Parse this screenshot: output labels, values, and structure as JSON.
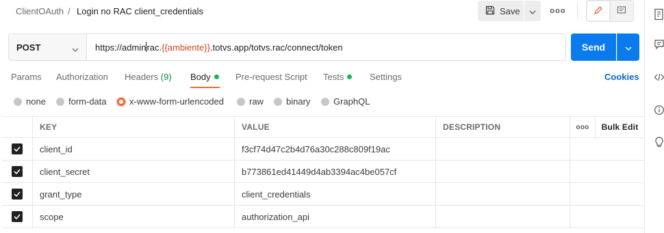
{
  "header": {
    "parent": "ClientOAuth",
    "separator": "/",
    "title": "Login no RAC client_credentials",
    "save_label": "Save",
    "more_label": "ooo"
  },
  "request": {
    "method": "POST",
    "url_prefix": "https://admin",
    "url_mid": "rac.",
    "url_var": "{{ambiente}}",
    "url_suffix": ".totvs.app/totvs.rac/connect/token",
    "send_label": "Send"
  },
  "tabs": [
    {
      "label": "Params"
    },
    {
      "label": "Authorization"
    },
    {
      "label": "Headers",
      "count": "(9)"
    },
    {
      "label": "Body"
    },
    {
      "label": "Pre-request Script"
    },
    {
      "label": "Tests"
    },
    {
      "label": "Settings"
    }
  ],
  "cookies_label": "Cookies",
  "body_types": [
    {
      "label": "none"
    },
    {
      "label": "form-data"
    },
    {
      "label": "x-www-form-urlencoded"
    },
    {
      "label": "raw"
    },
    {
      "label": "binary"
    },
    {
      "label": "GraphQL"
    }
  ],
  "selected_body_type": "x-www-form-urlencoded",
  "table": {
    "columns": {
      "key": "KEY",
      "value": "VALUE",
      "description": "DESCRIPTION",
      "more": "ooo",
      "bulk_edit": "Bulk Edit"
    },
    "rows": [
      {
        "key": "client_id",
        "value": "f3cf74d47c2b4d76a30c288c809f19ac",
        "description": "",
        "checked": true
      },
      {
        "key": "client_secret",
        "value": "b773861ed41449d4ab3394ac4be057cf",
        "description": "",
        "checked": true
      },
      {
        "key": "grant_type",
        "value": "client_credentials",
        "description": "",
        "checked": true
      },
      {
        "key": "scope",
        "value": "authorization_api",
        "description": "",
        "checked": true
      }
    ]
  },
  "colors": {
    "accent": "#f26b3a",
    "send": "#097bed",
    "active_dot": "#0cbb52",
    "variable": "#d1421a"
  }
}
